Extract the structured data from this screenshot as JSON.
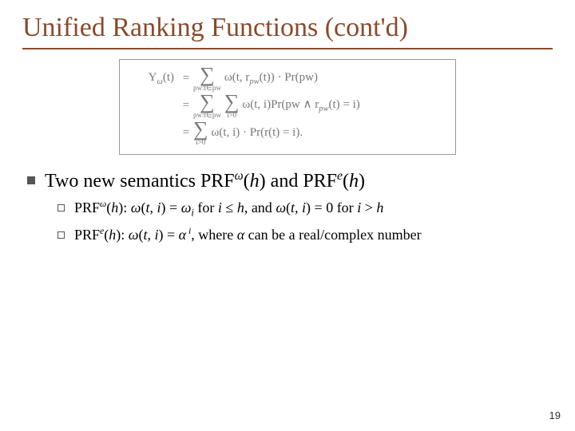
{
  "title": "Unified Ranking Functions (cont'd)",
  "equation": {
    "lhs": "Υ",
    "lhs_sub": "ω",
    "lhs_arg": "(t)",
    "rows": [
      {
        "sums": [
          {
            "sub": "pw:t∈pw"
          }
        ],
        "body_a": "ω(t, r",
        "body_b": "pw",
        "body_c": "(t)) · Pr(pw)"
      },
      {
        "sums": [
          {
            "sub": "pw:t∈pw"
          },
          {
            "sub": "i>0"
          }
        ],
        "body_a": "ω(t, i)Pr(pw ∧ r",
        "body_b": "pw",
        "body_c": "(t) = i)"
      },
      {
        "sums": [
          {
            "sub": "i>0"
          }
        ],
        "body_a": "ω(t, i) · Pr(r(t) = i).",
        "body_b": "",
        "body_c": ""
      }
    ]
  },
  "bullet1": {
    "t1": "Two new semantics PRF",
    "s1": "ω",
    "t2": "(",
    "h1": "h",
    "t3": ") and PRF",
    "s2": "e",
    "t4": "(",
    "h2": "h",
    "t5": ")"
  },
  "sub1": {
    "a": "PRF",
    "sup": "ω",
    "b": "(",
    "h": "h",
    "c": "): ",
    "d": "ω",
    "e": "(",
    "t": "t, i",
    "f": ") = ",
    "g": "ω",
    "gi": "i",
    "h2": " for ",
    "i": "i",
    "le": " ≤ ",
    "hh": "h",
    "j": ", and ",
    "k": "ω",
    "l": "(",
    "t2": "t, i",
    "m": ") = 0 for ",
    "i2": "i",
    "gt": " > ",
    "hh2": "h"
  },
  "sub2": {
    "a": "PRF",
    "sup": "e",
    "b": "(",
    "h": "h",
    "c": "): ",
    "d": "ω",
    "e": "(",
    "t": "t, i",
    "f": ") = ",
    "g": "α",
    "gi": " i",
    "h2": ", where ",
    "al": "α",
    "j": " can be a real/complex number"
  },
  "page": "19"
}
